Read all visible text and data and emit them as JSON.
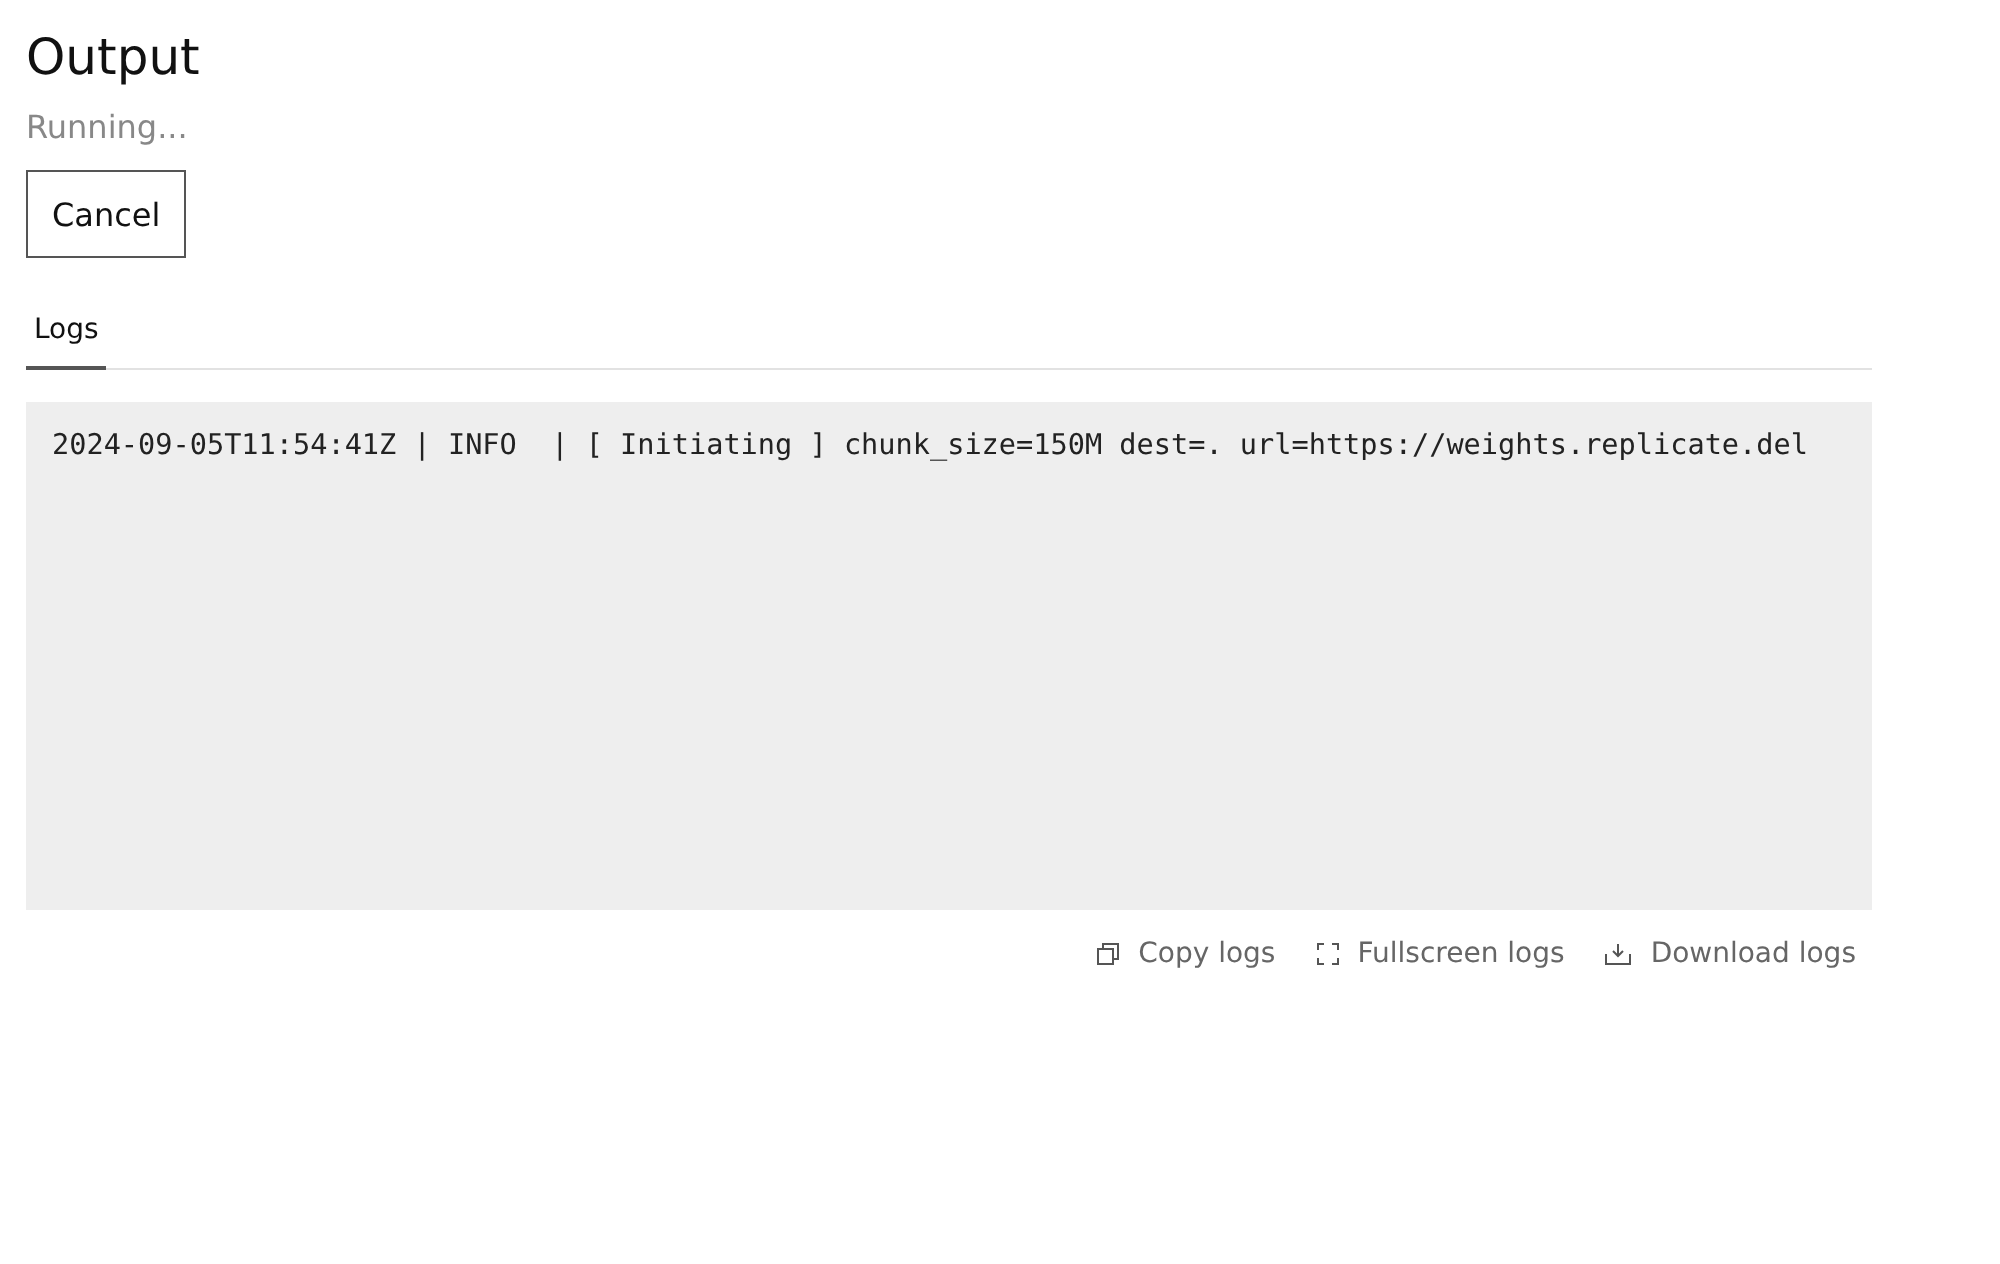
{
  "title": "Output",
  "status": "Running...",
  "cancel_button": "Cancel",
  "tabs": [
    {
      "label": "Logs",
      "selected": true
    }
  ],
  "log_lines": [
    "2024-09-05T11:54:41Z | INFO  | [ Initiating ] chunk_size=150M dest=. url=https://weights.replicate.del"
  ],
  "actions": [
    {
      "kind": "copy",
      "label": "Copy logs"
    },
    {
      "kind": "fullscreen",
      "label": "Fullscreen logs"
    },
    {
      "kind": "download",
      "label": "Download logs"
    }
  ]
}
